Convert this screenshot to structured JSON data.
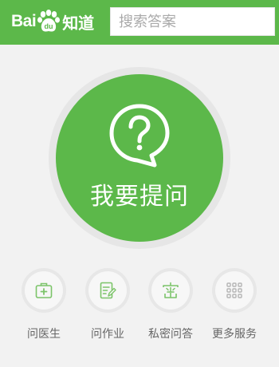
{
  "header": {
    "logo_text_left": "Bai",
    "logo_paw_text": "du",
    "logo_text_right": "知道",
    "search_placeholder": "搜索答案"
  },
  "ask": {
    "label": "我要提问",
    "icon": "question-bubble-icon"
  },
  "shortcuts": [
    {
      "label": "问医生",
      "icon": "medical-kit-icon"
    },
    {
      "label": "问作业",
      "icon": "homework-icon"
    },
    {
      "label": "私密问答",
      "icon": "private-icon"
    },
    {
      "label": "更多服务",
      "icon": "grid-icon"
    }
  ],
  "colors": {
    "brand_green": "#5cb84a",
    "icon_green": "#7cc46a",
    "icon_gray": "#b5b5b5"
  }
}
